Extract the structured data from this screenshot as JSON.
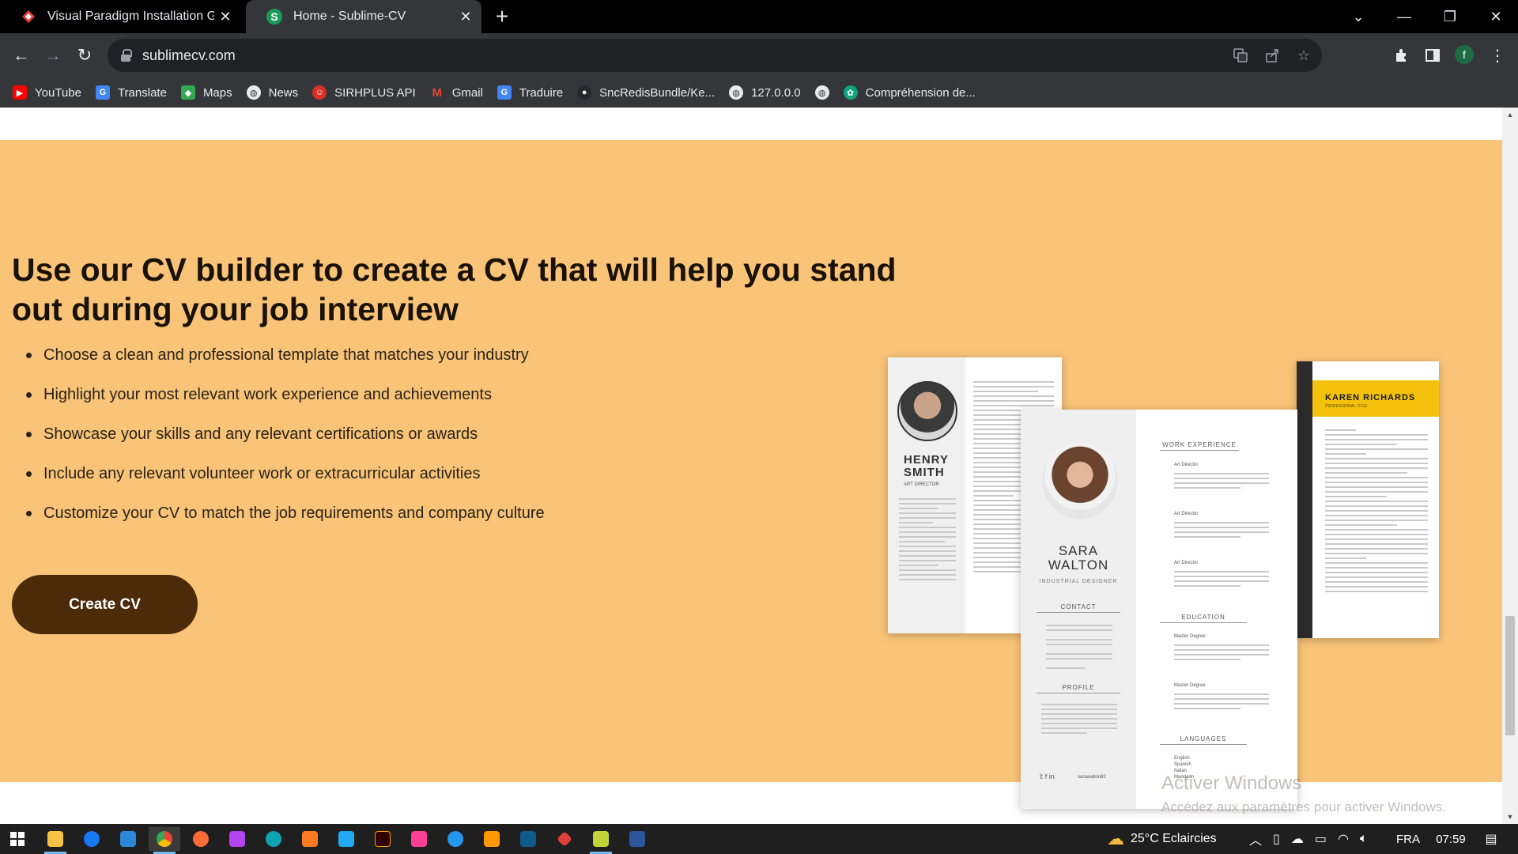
{
  "browser": {
    "tabs": [
      {
        "title": "Visual Paradigm Installation Guide",
        "active": false
      },
      {
        "title": "Home - Sublime-CV",
        "active": true
      }
    ],
    "new_tab": "+",
    "url": "sublimecv.com",
    "profile_initial": "f"
  },
  "bookmarks": [
    {
      "label": "YouTube",
      "icon": "youtube-icon",
      "color": "#ff0000"
    },
    {
      "label": "Translate",
      "icon": "translate-icon",
      "color": "#4285f4"
    },
    {
      "label": "Maps",
      "icon": "maps-icon",
      "color": "#34a853"
    },
    {
      "label": "News",
      "icon": "globe-icon",
      "color": "#5f6368"
    },
    {
      "label": "SIRHPLUS API",
      "icon": "sirhplus-icon",
      "color": "#d93025"
    },
    {
      "label": "Gmail",
      "icon": "gmail-icon",
      "color": "#ea4335"
    },
    {
      "label": "Traduire",
      "icon": "translate-icon",
      "color": "#4285f4"
    },
    {
      "label": "SncRedisBundle/Ke...",
      "icon": "github-icon",
      "color": "#24292e"
    },
    {
      "label": "127.0.0.0",
      "icon": "globe-icon",
      "color": "#5f6368"
    },
    {
      "label": "",
      "icon": "globe-icon",
      "color": "#5f6368"
    },
    {
      "label": "Compréhension de...",
      "icon": "openai-icon",
      "color": "#10a37f"
    }
  ],
  "hero": {
    "headline": "Use our CV builder to create a CV that will help you stand out during your job interview",
    "features": [
      "Choose a clean and professional template that matches your industry",
      "Highlight your most relevant work experience and achievements",
      "Showcase your skills and any relevant certifications or awards",
      "Include any relevant volunteer work or extracurricular activities",
      "Customize your CV to match the job requirements and company culture"
    ],
    "cta_label": "Create CV",
    "background": "#f9c378",
    "cta_color": "#4b2b0a"
  },
  "cv_templates": {
    "left": {
      "name_line1": "HENRY",
      "name_line2": "SMITH",
      "role": "ART DIRECTOR"
    },
    "center": {
      "name_line1": "SARA",
      "name_line2": "WALTON",
      "role": "INDUSTRIAL DESIGNER",
      "contact_heading": "CONTACT",
      "profile_heading": "PROFILE",
      "work_heading": "WORK EXPERIENCE",
      "education_heading": "EDUCATION",
      "languages_heading": "LANGUAGES",
      "jobs": [
        "Art Director",
        "Art Director",
        "Art Director"
      ],
      "degrees": [
        "Master Degree",
        "Master Degree"
      ],
      "languages": [
        "English",
        "Spanish",
        "Italian",
        "Mandarin"
      ],
      "social_handle": "sarawalton82"
    },
    "right": {
      "name": "KAREN RICHARDS",
      "subtitle": "PROFESSIONAL TITLE"
    }
  },
  "watermark": {
    "line1": "Activer Windows",
    "line2": "Accédez aux paramètres pour activer Windows."
  },
  "taskbar": {
    "weather": "25°C Eclaircies",
    "language": "FRA",
    "time": "07:59"
  }
}
